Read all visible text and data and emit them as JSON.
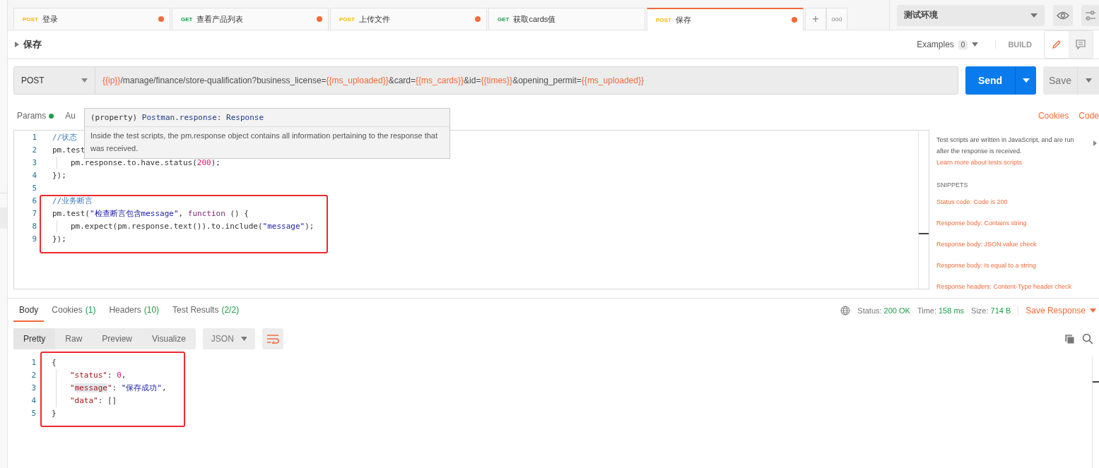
{
  "request_tabs": [
    {
      "method": "POST",
      "name": "登录",
      "modified": true,
      "selected": false
    },
    {
      "method": "GET",
      "name": "查看产品列表",
      "modified": true,
      "selected": false
    },
    {
      "method": "POST",
      "name": "上传文件",
      "modified": true,
      "selected": false
    },
    {
      "method": "GET",
      "name": "获取cards值",
      "modified": false,
      "selected": false
    },
    {
      "method": "POST",
      "name": "保存",
      "modified": true,
      "selected": true
    }
  ],
  "tab_actions": {
    "new": "+",
    "more": "ooo"
  },
  "environment": {
    "value": "测试环境"
  },
  "request_title": "保存",
  "examples": {
    "label": "Examples",
    "count": "0"
  },
  "build_label": "BUILD",
  "method": "POST",
  "url": [
    {
      "text": "{{ip}}",
      "kind": "variable"
    },
    {
      "text": "/manage/finance/store-qualification?business_license=",
      "kind": "plain"
    },
    {
      "text": "{{ms_uploaded}}",
      "kind": "variable"
    },
    {
      "text": "&card=",
      "kind": "plain"
    },
    {
      "text": "{{ms_cards}}",
      "kind": "variable"
    },
    {
      "text": "&id=",
      "kind": "plain"
    },
    {
      "text": "{{times}}",
      "kind": "variable"
    },
    {
      "text": "&opening_permit=",
      "kind": "plain"
    },
    {
      "text": "{{ms_uploaded}}",
      "kind": "variable"
    }
  ],
  "send_button": "Send",
  "save_button": "Save",
  "request_sections": [
    {
      "label": "Params",
      "has_dot": true
    },
    {
      "label": "Au",
      "has_dot": false
    }
  ],
  "request_links": [
    "Cookies",
    "Code"
  ],
  "test_script": [
    {
      "number": "1",
      "tokens": [
        {
          "text": "//状态",
          "kind": "comment"
        }
      ]
    },
    {
      "number": "2",
      "tokens": [
        {
          "text": "pm.test",
          "kind": "plain"
        }
      ]
    },
    {
      "number": "3",
      "indent": true,
      "tokens": [
        {
          "text": "pm.response.to.have.status(",
          "kind": "plain"
        },
        {
          "text": "200",
          "kind": "number"
        },
        {
          "text": ");",
          "kind": "plain"
        }
      ]
    },
    {
      "number": "4",
      "tokens": [
        {
          "text": "});",
          "kind": "plain"
        }
      ]
    },
    {
      "number": "5"
    },
    {
      "number": "6",
      "tokens": [
        {
          "text": "//业务断言",
          "kind": "comment"
        }
      ]
    },
    {
      "number": "7",
      "tokens": [
        {
          "text": "pm.test(",
          "kind": "plain"
        },
        {
          "text": "\"检查断言包含message\"",
          "kind": "string"
        },
        {
          "text": ", ",
          "kind": "plain"
        },
        {
          "text": "function",
          "kind": "keyword"
        },
        {
          "text": " () {",
          "kind": "plain"
        }
      ]
    },
    {
      "number": "8",
      "indent": true,
      "tokens": [
        {
          "text": "pm.expect(pm.response.text()).to.include(",
          "kind": "plain"
        },
        {
          "text": "\"message\"",
          "kind": "string"
        },
        {
          "text": ");",
          "kind": "plain"
        }
      ]
    },
    {
      "number": "9",
      "tokens": [
        {
          "text": "});",
          "kind": "plain"
        }
      ]
    }
  ],
  "tooltip": {
    "signature": [
      {
        "text": "(property) ",
        "kind": "plain"
      },
      {
        "text": "Postman.response",
        "kind": "type"
      },
      {
        "text": ": ",
        "kind": "plain"
      },
      {
        "text": "Response",
        "kind": "type"
      }
    ],
    "description": "Inside the test scripts, the pm.response object contains all information pertaining to the response that was received."
  },
  "help_panel": {
    "intro": "Test scripts are written in JavaScript, and are run after the response is received.",
    "learn_link": "Learn more about tests scripts",
    "snippets_heading": "SNIPPETS",
    "snippets": [
      "Status code: Code is 200",
      "Response body: Contains string",
      "Response body: JSON value check",
      "Response body: Is equal to a string",
      "Response headers: Content-Type header check"
    ]
  },
  "response_tabs": [
    {
      "label": "Body",
      "selected": true
    },
    {
      "label": "Cookies",
      "count": "(1)",
      "selected": false
    },
    {
      "label": "Headers",
      "count": "(10)",
      "selected": false
    },
    {
      "label": "Test Results",
      "count": "(2/2)",
      "selected": false
    }
  ],
  "response_meta": [
    {
      "label": "Status:",
      "value": "200 OK"
    },
    {
      "label": "Time:",
      "value": "158 ms"
    },
    {
      "label": "Size:",
      "value": "714 B"
    }
  ],
  "save_response": "Save Response",
  "view_modes": [
    {
      "label": "Pretty",
      "selected": true
    },
    {
      "label": "Raw",
      "selected": false
    },
    {
      "label": "Preview",
      "selected": false
    },
    {
      "label": "Visualize",
      "selected": false
    }
  ],
  "format": "JSON",
  "response_body": [
    {
      "number": "1",
      "tokens": [
        {
          "text": "{",
          "kind": "plain"
        }
      ]
    },
    {
      "number": "2",
      "indent": true,
      "tokens": [
        {
          "text": "\"status\"",
          "kind": "key"
        },
        {
          "text": ": ",
          "kind": "plain"
        },
        {
          "text": "0",
          "kind": "number"
        },
        {
          "text": ",",
          "kind": "plain"
        }
      ]
    },
    {
      "number": "3",
      "indent": true,
      "tokens": [
        {
          "text": "\"",
          "kind": "key"
        },
        {
          "text": "message",
          "kind": "key_highlight"
        },
        {
          "text": "\"",
          "kind": "key"
        },
        {
          "text": ": ",
          "kind": "plain"
        },
        {
          "text": "\"保存成功\"",
          "kind": "string"
        },
        {
          "text": ",",
          "kind": "plain"
        }
      ]
    },
    {
      "number": "4",
      "indent": true,
      "tokens": [
        {
          "text": "\"data\"",
          "kind": "key"
        },
        {
          "text": ": []",
          "kind": "plain"
        }
      ]
    },
    {
      "number": "5",
      "tokens": [
        {
          "text": "}",
          "kind": "plain"
        }
      ]
    }
  ]
}
